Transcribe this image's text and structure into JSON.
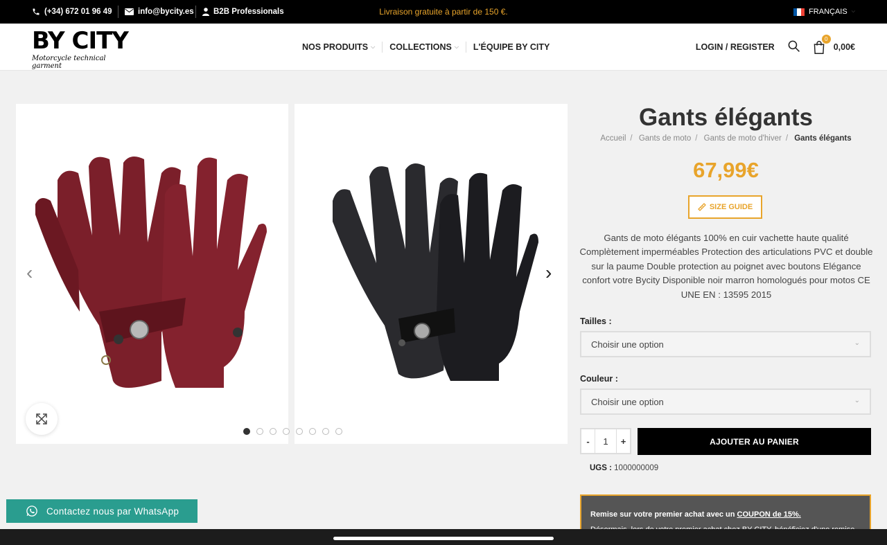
{
  "topbar": {
    "phone": "(+34) 672 01 96 49",
    "email": "info@bycity.es",
    "b2b": "B2B Professionals",
    "promo": "Livraison gratuite à partir de 150 €.",
    "language": "FRANÇAIS"
  },
  "header": {
    "logo_text": "BY CITY",
    "logo_tagline": "Motorcycle technical garment",
    "nav": [
      "NOS PRODUITS",
      "COLLECTIONS",
      "L'ÉQUIPE BY CITY"
    ],
    "login": "LOGIN / REGISTER",
    "cart_count": "0",
    "cart_total": "0,00€"
  },
  "product": {
    "title": "Gants élégants",
    "breadcrumbs": [
      "Accueil",
      "Gants de moto",
      "Gants de moto d'hiver",
      "Gants élégants"
    ],
    "price": "67,99€",
    "size_guide": "SIZE GUIDE",
    "description": "Gants de moto élégants 100% en cuir vachette haute qualité Complètement imperméables Protection des articulations PVC et double sur la paume Double protection au poignet avec boutons Elégance confort votre Bycity Disponible noir marron homologués pour motos CE UNE EN : 13595 2015",
    "size_label": "Tailles",
    "size_placeholder": "Choisir une option",
    "color_label": "Couleur",
    "color_placeholder": "Choisir une option",
    "qty_minus": "-",
    "qty_value": "1",
    "qty_plus": "+",
    "add_to_cart": "AJOUTER AU PANIER",
    "sku_label": "UGS :",
    "sku_value": "1000000009",
    "coupon_text": "Remise sur votre premier achat avec un",
    "coupon_link": "COUPON de 15%.",
    "coupon_more": "Désormais, lors de votre premier achat chez BY CITY, bénéficiez d'une remise"
  },
  "gallery": {
    "dots_count": 8,
    "active_dot": 0,
    "images": [
      "burgundy-gloves",
      "black-gloves"
    ]
  },
  "whatsapp": {
    "label": "Contactez nous par WhatsApp"
  },
  "colors": {
    "accent": "#e8a42b",
    "whatsapp": "#2a9d8f",
    "topbar": "#000000"
  }
}
